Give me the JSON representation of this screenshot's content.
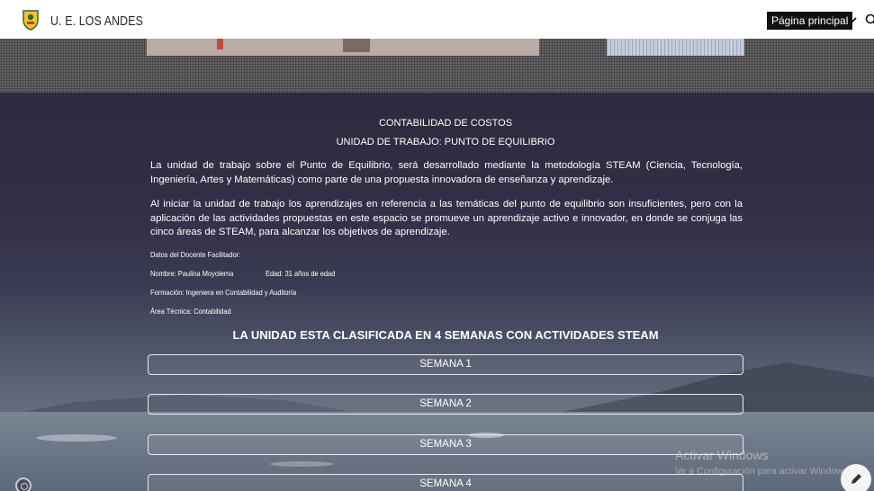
{
  "header": {
    "site_title": "U. E. LOS ANDES",
    "nav_current": "Página principal",
    "icons": [
      "school-logo",
      "chevron-down-icon",
      "search-icon"
    ]
  },
  "content": {
    "title_1": "CONTABILIDAD DE COSTOS",
    "title_2": "UNIDAD DE TRABAJO: PUNTO DE EQUILIBRIO",
    "paragraph_1": "La unidad de trabajo sobre el Punto de Equilibrio, será desarrollado mediante la metodología STEAM (Ciencia, Tecnología, Ingeniería, Artes y Matemáticas) como parte de una propuesta innovadora de enseñanza y aprendizaje.",
    "paragraph_2": "Al iniciar la unidad de trabajo los aprendizajes en referencia a las temáticas del punto de equilibrio son insuficientes, pero con la aplicación de las actividades propuestas en este espacio se promueve un aprendizaje activo e innovador, en donde se conjuga las cinco áreas de STEAM, para alcanzar los objetivos de aprendizaje.",
    "teacher": {
      "heading": "Datos del Docente Facilitador:",
      "name": "Nombre: Paulina Moyolema",
      "age": "Edad: 31 años de edad",
      "education": "Formación: Ingeniera en Contabilidad y Auditoría",
      "area": "Área Técnica: Contabilidad"
    },
    "section_heading": "LA UNIDAD ESTA CLASIFICADA EN 4 SEMANAS CON ACTIVIDADES STEAM",
    "weeks": [
      "SEMANA 1",
      "SEMANA 2",
      "SEMANA 3",
      "SEMANA 4"
    ]
  },
  "os_watermark": {
    "line1": "Activar Windows",
    "line2": "Ve a Configuración para activar Windows."
  },
  "colors": {
    "header_bg": "#ffffff",
    "nav_active_bg": "#111111",
    "content_bg": "#2c2a3e",
    "text": "#ffffff"
  }
}
